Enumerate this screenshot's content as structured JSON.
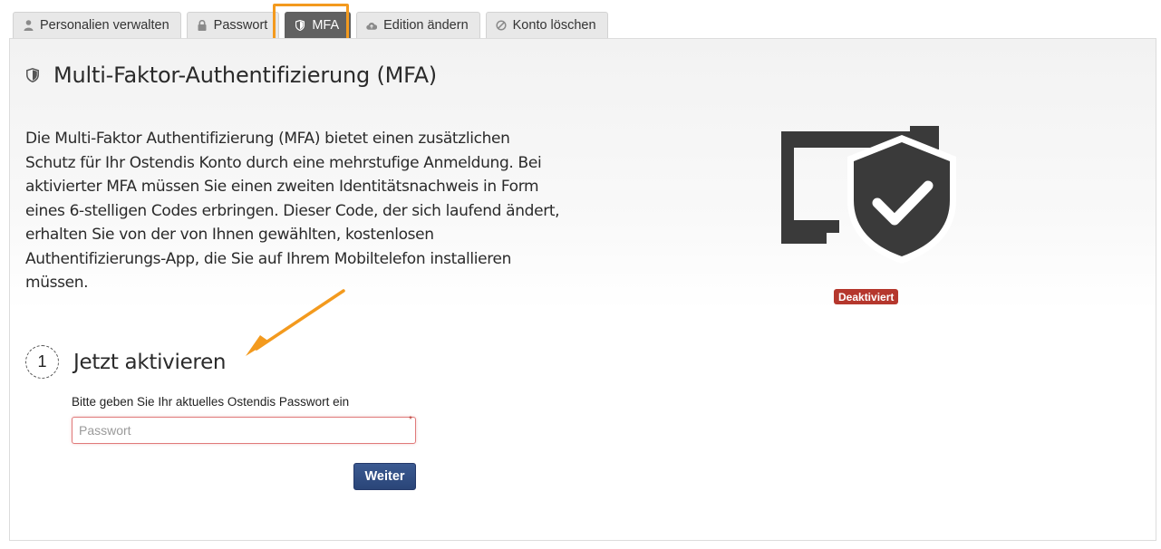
{
  "tabs": [
    {
      "label": "Personalien verwalten",
      "icon": "user-icon",
      "active": false
    },
    {
      "label": "Passwort",
      "icon": "lock-icon",
      "active": false
    },
    {
      "label": "MFA",
      "icon": "shield-icon",
      "active": true
    },
    {
      "label": "Edition ändern",
      "icon": "cloud-upload-icon",
      "active": false
    },
    {
      "label": "Konto löschen",
      "icon": "ban-icon",
      "active": false
    }
  ],
  "colors": {
    "highlight": "#f39a1e",
    "active_tab": "#616161",
    "badge": "#b5372d",
    "button": "#2f4c80",
    "illustration": "#3a3a3a"
  },
  "heading": {
    "title": "Multi-Faktor-Authentifizierung (MFA)",
    "icon": "shield-icon"
  },
  "intro_lines": [
    "Die Multi-Faktor Authentifizierung (MFA) bietet einen zusätzlichen",
    "Schutz für Ihr Ostendis Konto durch eine mehrstufige Anmeldung. Bei",
    "aktivierter MFA müssen Sie einen zweiten Identitätsnachweis in Form",
    "eines 6-stelligen Codes erbringen. Dieser Code, der sich laufend ändert,",
    "erhalten Sie von der von Ihnen gewählten, kostenlosen",
    "Authentifizierungs-App, die Sie auf Ihrem Mobiltelefon installieren",
    "müssen."
  ],
  "illustration": {
    "icon": "monitor-shield-check-icon"
  },
  "status_badge": "Deaktiviert",
  "step": {
    "number": "1",
    "title": "Jetzt aktivieren",
    "password_label": "Bitte geben Sie Ihr aktuelles Ostendis Passwort ein",
    "password_placeholder": "Passwort",
    "password_value": "",
    "required_marker": "*",
    "submit_label": "Weiter"
  }
}
